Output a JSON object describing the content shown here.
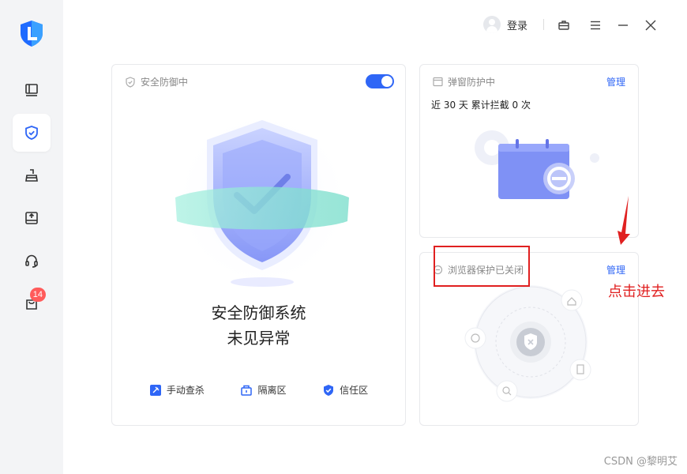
{
  "sidebar": {
    "items": [
      {
        "icon": "monitor-icon"
      },
      {
        "icon": "shield-check-icon",
        "active": true
      },
      {
        "icon": "broom-icon"
      },
      {
        "icon": "upload-box-icon"
      },
      {
        "icon": "headset-icon"
      },
      {
        "icon": "bag-icon",
        "badge": "14"
      }
    ]
  },
  "topbar": {
    "login_label": "登录"
  },
  "protection_card": {
    "title": "安全防御中",
    "toggle_on": true,
    "status_line1": "安全防御系统",
    "status_line2": "未见异常",
    "actions": [
      "手动查杀",
      "隔离区",
      "信任区"
    ]
  },
  "popup_card": {
    "title": "弹窗防护中",
    "manage": "管理",
    "stat": "近 30 天 累计拦截 0 次"
  },
  "browser_card": {
    "title": "浏览器保护已关闭",
    "manage": "管理"
  },
  "annotation": {
    "text": "点击进去"
  },
  "watermark": "CSDN @黎明艾",
  "colors": {
    "accent": "#2f66f6",
    "annotation_red": "#e02020",
    "badge_red": "#ff5b5b"
  }
}
